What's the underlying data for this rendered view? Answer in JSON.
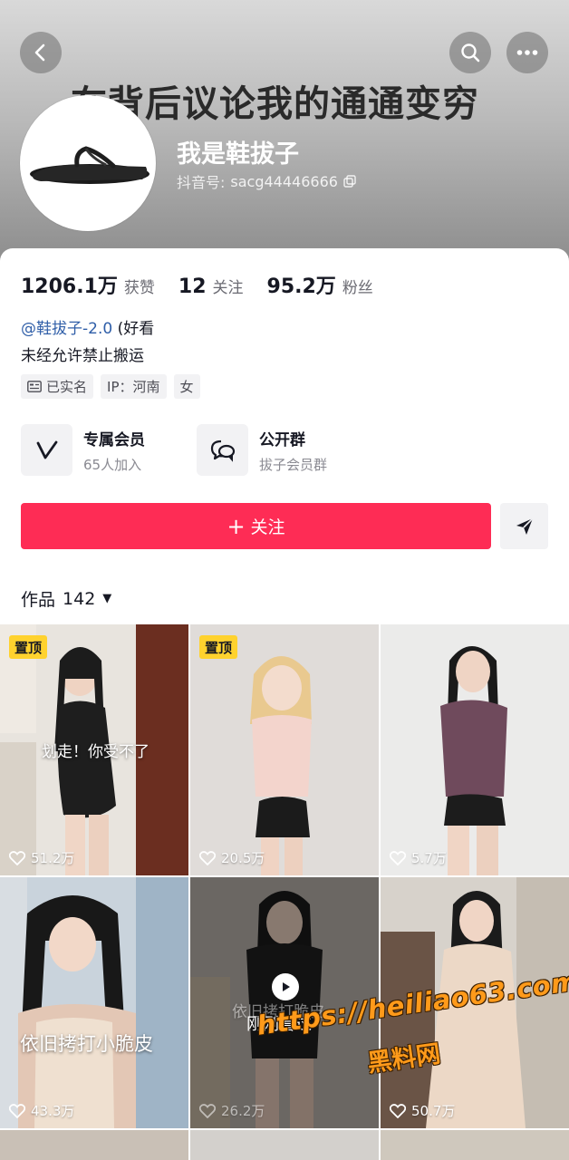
{
  "header": {
    "banner_text": "在背后议论我的通通变穷",
    "nickname": "我是鞋拔子",
    "id_label": "抖音号:",
    "id_value": "sacg44446666",
    "icons": {
      "back": "chevron-left-icon",
      "search": "search-icon",
      "more": "more-dots-icon",
      "copy": "copy-icon"
    }
  },
  "stats": [
    {
      "value": "1206.1万",
      "label": "获赞"
    },
    {
      "value": "12",
      "label": "关注"
    },
    {
      "value": "95.2万",
      "label": "粉丝"
    }
  ],
  "bio": {
    "mention": "@鞋拔子-2.0",
    "mention_rest": " (好看",
    "line2": "未经允许禁止搬运"
  },
  "tags": {
    "verified": "已实名",
    "ip": "IP：河南",
    "gender": "女"
  },
  "features": {
    "member": {
      "title": "专属会员",
      "subtitle": "65人加入"
    },
    "group": {
      "title": "公开群",
      "subtitle": "拔子会员群"
    }
  },
  "actions": {
    "follow_label": "关注",
    "follow_prefix": "+"
  },
  "works": {
    "label": "作品",
    "count": "142"
  },
  "videos": [
    {
      "pinned": "置顶",
      "likes": "51.2万",
      "caption": "划走！你受不了"
    },
    {
      "pinned": "置顶",
      "likes": "20.5万",
      "caption": ""
    },
    {
      "pinned": "",
      "likes": "5.7万",
      "caption": ""
    },
    {
      "pinned": "",
      "likes": "43.3万",
      "caption": "依旧拷打小脆皮"
    },
    {
      "pinned": "",
      "likes": "26.2万",
      "caption": "依旧拷打脆皮",
      "overlay": "刚刚看过"
    },
    {
      "pinned": "",
      "likes": "50.7万",
      "caption": ""
    }
  ],
  "watermark": {
    "url": "https://heiliao63.com",
    "name": "黑料网"
  },
  "colors": {
    "accent": "#fe2c55",
    "pin_badge": "#ffd22e",
    "mention": "#2f5ea8",
    "watermark": "#ff9a1a"
  }
}
